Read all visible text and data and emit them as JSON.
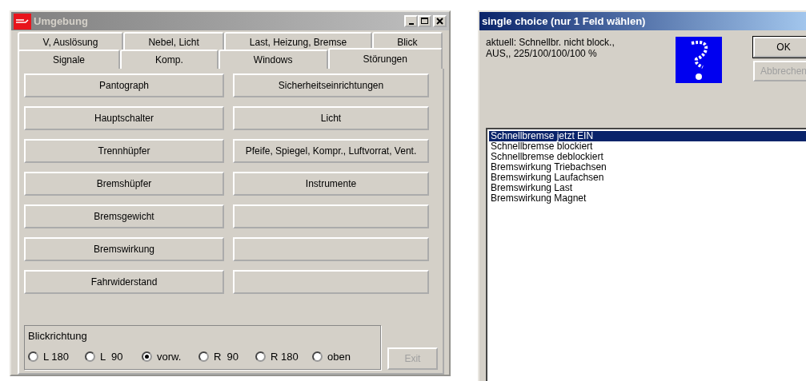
{
  "main_window": {
    "title": "Umgebung",
    "active": false,
    "tab_rows": [
      [
        {
          "label": "V, Auslösung",
          "selected": false
        },
        {
          "label": "Nebel, Licht",
          "selected": false
        },
        {
          "label": "Last, Heizung, Bremse",
          "selected": false
        },
        {
          "label": "Blick",
          "selected": false
        }
      ],
      [
        {
          "label": "Signale",
          "selected": false
        },
        {
          "label": "Komp.",
          "selected": false
        },
        {
          "label": "Windows",
          "selected": false
        },
        {
          "label": "Störungen",
          "selected": true
        }
      ]
    ],
    "button_rows": [
      [
        {
          "kind": "labeled",
          "label": "Pantograph"
        },
        {
          "kind": "labeled",
          "label": "Sicherheitseinrichtungen"
        }
      ],
      [
        {
          "kind": "labeled",
          "label": "Hauptschalter"
        },
        {
          "kind": "labeled",
          "label": "Licht"
        }
      ],
      [
        {
          "kind": "labeled",
          "label": "Trennhüpfer"
        },
        {
          "kind": "labeled",
          "label": "Pfeife, Spiegel, Kompr., Luftvorrat, Vent."
        }
      ],
      [
        {
          "kind": "labeled",
          "label": "Bremshüpfer"
        },
        {
          "kind": "labeled",
          "label": "Instrumente"
        }
      ],
      [
        {
          "kind": "labeled",
          "label": "Bremsgewicht"
        },
        {
          "kind": "blank"
        }
      ],
      [
        {
          "kind": "labeled",
          "label": "Bremswirkung"
        },
        {
          "kind": "blank"
        }
      ],
      [
        {
          "kind": "labeled",
          "label": "Fahrwiderstand"
        },
        {
          "kind": "blank"
        }
      ]
    ],
    "view_group": {
      "title": "Blickrichtung",
      "options": [
        {
          "label": "L 180",
          "selected": false
        },
        {
          "label": "L  90",
          "selected": false
        },
        {
          "label": "vorw.",
          "selected": true
        },
        {
          "label": "R  90",
          "selected": false
        },
        {
          "label": "R 180",
          "selected": false
        },
        {
          "label": "oben",
          "selected": false
        }
      ]
    },
    "exit_button": {
      "label": "Exit",
      "disabled": true
    }
  },
  "choice_dialog": {
    "title": "single choice (nur 1 Feld wählen)",
    "active": true,
    "current_lines": [
      "aktuell: Schnellbr. nicht block.,",
      "AUS,, 225/100/100/100 %"
    ],
    "ok_button": {
      "label": "OK",
      "disabled": false
    },
    "cancel_button": {
      "label": "Abbrechen",
      "disabled": true
    },
    "list": [
      {
        "label": "Schnellbremse jetzt EIN",
        "selected": true
      },
      {
        "label": "Schnellbremse blockiert",
        "selected": false
      },
      {
        "label": "Schnellbremse deblockiert",
        "selected": false
      },
      {
        "label": "Bremswirkung Triebachsen",
        "selected": false
      },
      {
        "label": "Bremswirkung Laufachsen",
        "selected": false
      },
      {
        "label": "Bremswirkung Last",
        "selected": false
      },
      {
        "label": "Bremswirkung Magnet",
        "selected": false
      }
    ]
  }
}
